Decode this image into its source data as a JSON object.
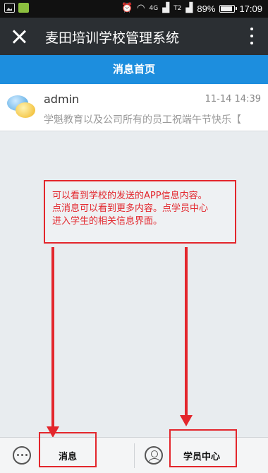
{
  "status_bar": {
    "network_tag": "4G",
    "network_sub": "T2",
    "battery": "89%",
    "battery_level": 0.89,
    "time": "17:09"
  },
  "app_bar": {
    "title": "麦田培训学校管理系统",
    "close_icon": "close-icon",
    "more_icon": "more-vert-icon"
  },
  "header": {
    "title": "消息首页"
  },
  "messages": [
    {
      "sender": "admin",
      "time": "11-14 14:39",
      "preview": "学魁教育以及公司所有的员工祝端午节快乐【",
      "icon": "chat-bubbles-icon"
    }
  ],
  "annotation": {
    "lines": [
      "可以看到学校的发送的APP信息内容。",
      "点消息可以看到更多内容。点学员中心",
      "进入学生的相关信息界面。"
    ],
    "color": "#e3262c"
  },
  "tabs": [
    {
      "label": "消息",
      "icon": "chat-icon"
    },
    {
      "label": "学员中心",
      "icon": "user-icon"
    }
  ],
  "colors": {
    "app_bar": "#2b2f33",
    "header": "#1d8ede",
    "accent_red": "#e3262c"
  }
}
